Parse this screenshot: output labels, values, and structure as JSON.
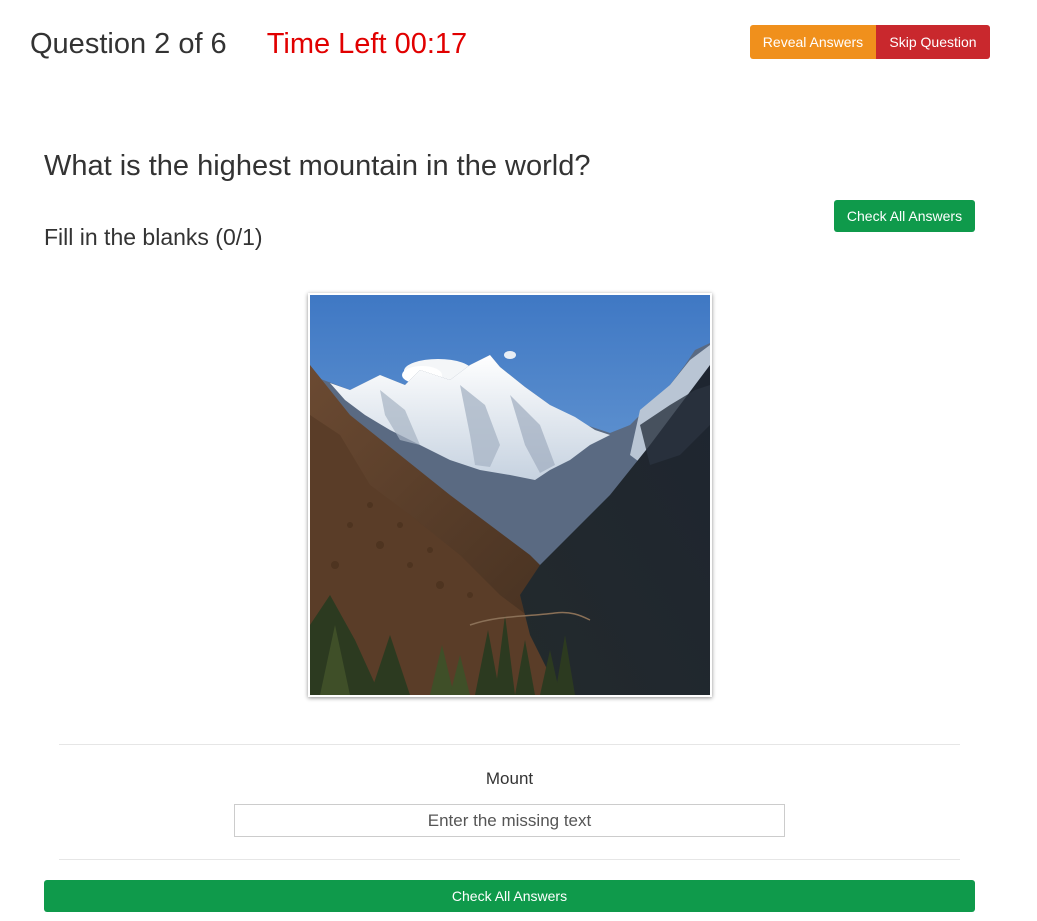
{
  "header": {
    "question_counter": "Question 2 of 6",
    "timer": "Time Left 00:17",
    "reveal_label": "Reveal Answers",
    "skip_label": "Skip Question"
  },
  "question": {
    "text": "What is the highest mountain in the world?",
    "instruction": "Fill in the blanks  (0/1)",
    "check_label": "Check All Answers"
  },
  "blank": {
    "prefix": "Mount",
    "value": "",
    "placeholder": "Enter the missing text"
  },
  "footer": {
    "check_label": "Check All Answers"
  },
  "colors": {
    "timer": "#e10000",
    "reveal": "#f0901c",
    "skip": "#c9282d",
    "check": "#0f9a4b"
  }
}
